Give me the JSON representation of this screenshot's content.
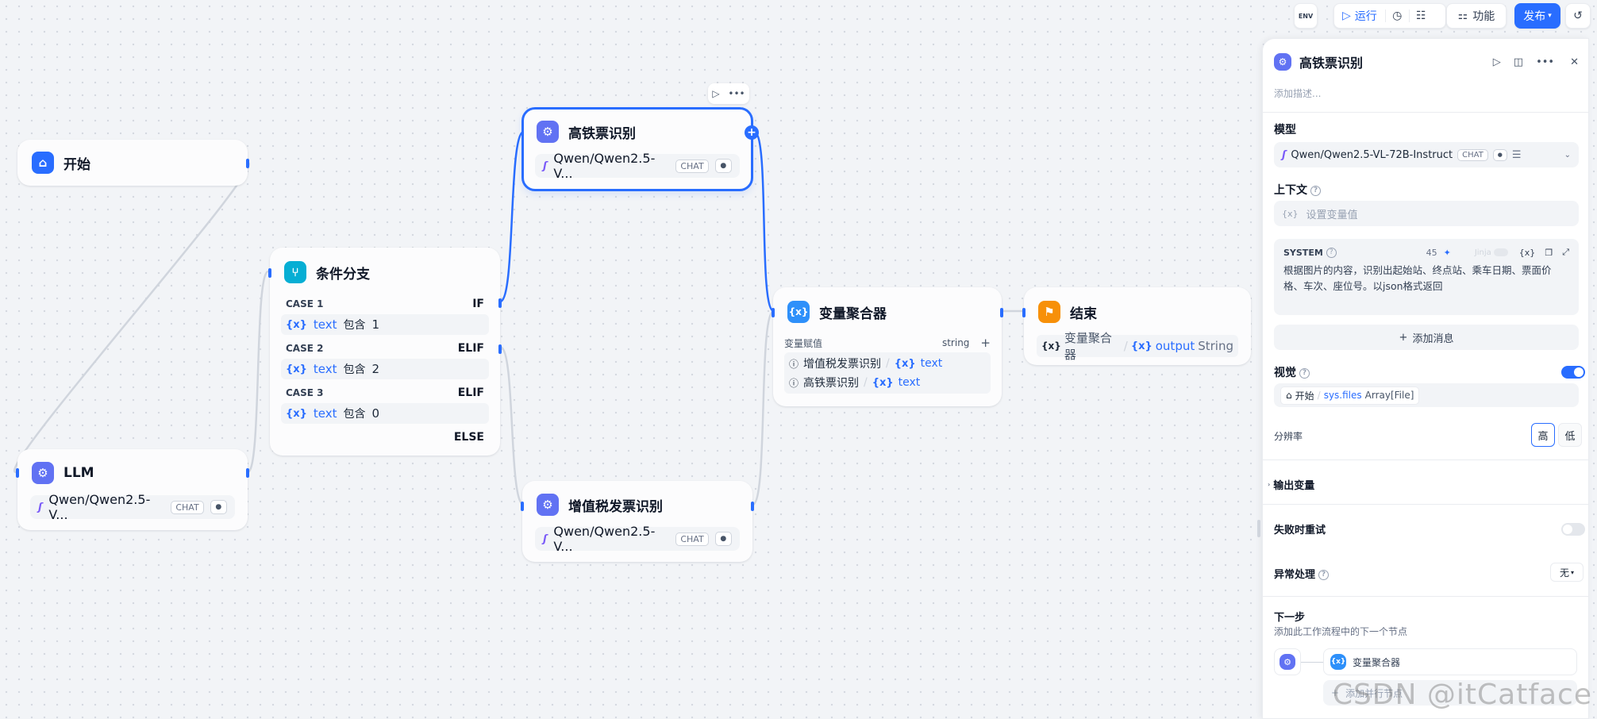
{
  "toolbar": {
    "env_label": "ENV",
    "run_label": "运行",
    "features_label": "功能",
    "publish_label": "发布"
  },
  "nodes": {
    "start": {
      "title": "开始"
    },
    "llm": {
      "title": "LLM",
      "model": "Qwen/Qwen2.5-V...",
      "tag": "CHAT"
    },
    "branch": {
      "title": "条件分支",
      "cases": [
        {
          "label": "CASE 1",
          "keyword": "IF",
          "var": "text",
          "op": "包含",
          "value": "1"
        },
        {
          "label": "CASE 2",
          "keyword": "ELIF",
          "var": "text",
          "op": "包含",
          "value": "2"
        },
        {
          "label": "CASE 3",
          "keyword": "ELIF",
          "var": "text",
          "op": "包含",
          "value": "0"
        }
      ],
      "else_label": "ELSE"
    },
    "train": {
      "title": "高铁票识别",
      "model": "Qwen/Qwen2.5-V...",
      "tag": "CHAT"
    },
    "vat": {
      "title": "增值税发票识别",
      "model": "Qwen/Qwen2.5-V...",
      "tag": "CHAT"
    },
    "aggregator": {
      "title": "变量聚合器",
      "assign_label": "变量赋值",
      "type": "string",
      "rows": [
        {
          "node": "增值税发票识别",
          "var": "text"
        },
        {
          "node": "高铁票识别",
          "var": "text"
        }
      ]
    },
    "end": {
      "title": "结束",
      "src": "变量聚合器",
      "var": "output",
      "type": "String"
    }
  },
  "panel": {
    "title": "高铁票识别",
    "desc_placeholder": "添加描述...",
    "model_label": "模型",
    "model_value": "Qwen/Qwen2.5-VL-72B-Instruct",
    "model_tag": "CHAT",
    "context_label": "上下文",
    "context_placeholder": "设置变量值",
    "system_label": "SYSTEM",
    "system_count": "45",
    "jinja_label": "Jinja",
    "system_text": "根据图片的内容，识别出起始站、终点站、乘车日期、票面价格、车次、座位号。以json格式返回",
    "add_message": "添加消息",
    "vision_label": "视觉",
    "vision_src": "开始",
    "vision_var": "sys.files",
    "vision_type": "Array[File]",
    "resolution_label": "分辨率",
    "res_high": "高",
    "res_low": "低",
    "output_vars": "输出变量",
    "retry_label": "失败时重试",
    "exception_label": "异常处理",
    "exception_value": "无",
    "next_label": "下一步",
    "next_desc": "添加此工作流程中的下一个节点",
    "next_node": "变量聚合器",
    "add_parallel": "添加并行节点"
  },
  "watermark": "CSDN @itCatface",
  "colors": {
    "accent": "#296dff",
    "edge": "#d0d5dd"
  }
}
